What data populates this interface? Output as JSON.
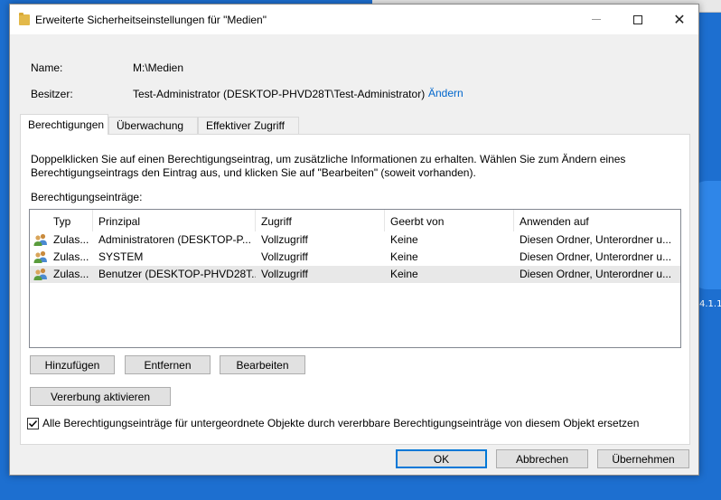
{
  "window": {
    "title": "Erweiterte Sicherheitseinstellungen für \"Medien\"",
    "minimize_label": "–",
    "maximize_label": "□",
    "close_label": "✕"
  },
  "fields": {
    "name_label": "Name:",
    "name_value": "M:\\Medien",
    "owner_label": "Besitzer:",
    "owner_value": "Test-Administrator (DESKTOP-PHVD28T\\Test-Administrator)",
    "owner_change_link": "Ändern"
  },
  "tabs": [
    {
      "label": "Berechtigungen",
      "active": true
    },
    {
      "label": "Überwachung",
      "active": false
    },
    {
      "label": "Effektiver Zugriff",
      "active": false
    }
  ],
  "panel": {
    "info_text": "Doppelklicken Sie auf einen Berechtigungseintrag, um zusätzliche Informationen zu erhalten. Wählen Sie zum Ändern eines Berechtigungseintrags den Eintrag aus, und klicken Sie auf \"Bearbeiten\" (soweit vorhanden).",
    "list_label": "Berechtigungseinträge:"
  },
  "table": {
    "columns": [
      "Typ",
      "Prinzipal",
      "Zugriff",
      "Geerbt von",
      "Anwenden auf"
    ],
    "rows": [
      {
        "type": "Zulas...",
        "principal": "Administratoren (DESKTOP-P...",
        "access": "Vollzugriff",
        "inherited": "Keine",
        "applies": "Diesen Ordner, Unterordner u...",
        "icon": "users-icon"
      },
      {
        "type": "Zulas...",
        "principal": "SYSTEM",
        "access": "Vollzugriff",
        "inherited": "Keine",
        "applies": "Diesen Ordner, Unterordner u...",
        "icon": "users-icon"
      },
      {
        "type": "Zulas...",
        "principal": "Benutzer (DESKTOP-PHVD28T...",
        "access": "Vollzugriff",
        "inherited": "Keine",
        "applies": "Diesen Ordner, Unterordner u...",
        "icon": "users-icon"
      }
    ]
  },
  "buttons": {
    "add": "Hinzufügen",
    "remove": "Entfernen",
    "edit": "Bearbeiten",
    "enable_inheritance": "Vererbung aktivieren",
    "ok": "OK",
    "cancel": "Abbrechen",
    "apply": "Übernehmen"
  },
  "checkbox": {
    "label": "Alle Berechtigungseinträge für untergeordnete Objekte durch vererbbare Berechtigungseinträge von diesem Objekt ersetzen",
    "checked": true
  },
  "colors": {
    "accent": "#0078d7",
    "link": "#0066cc",
    "selected_row": "#e8e8e8"
  }
}
